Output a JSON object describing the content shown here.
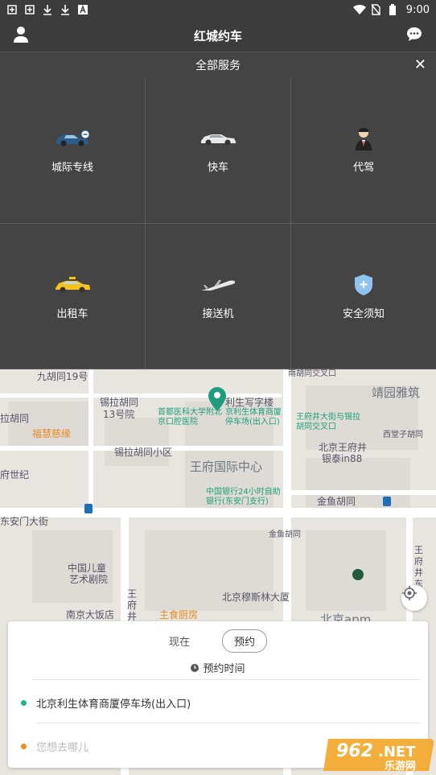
{
  "status_bar": {
    "time": "9:00"
  },
  "app_bar": {
    "title": "红城约车"
  },
  "services": {
    "header": "全部服务",
    "close_symbol": "✕",
    "items": [
      {
        "label": "城际专线",
        "icon": "intercity-car-icon"
      },
      {
        "label": "快车",
        "icon": "express-car-icon"
      },
      {
        "label": "代驾",
        "icon": "chauffeur-icon"
      },
      {
        "label": "出租车",
        "icon": "taxi-icon"
      },
      {
        "label": "接送机",
        "icon": "airplane-icon"
      },
      {
        "label": "安全须知",
        "icon": "shield-icon"
      }
    ]
  },
  "map": {
    "labels": [
      "九胡同19号",
      "锡拉胡同",
      "13号院",
      "拉胡同",
      "福慧慈缘",
      "锡拉胡同小区",
      "王府国际中心",
      "府世纪",
      "东安门大街",
      "中国儿童",
      "艺术剧院",
      "南京大饭店",
      "王府井",
      "主食厨房",
      "北京穆斯林大厦",
      "北京王府井",
      "银泰in88",
      "金鱼胡同",
      "金鱼胡同",
      "西堂子胡同",
      "王府井东街",
      "靖园雅筑",
      "利生写字楼",
      "首都医科大学附北京口腔医院",
      "京利生体育商厦停车场(出入口)",
      "王府井大街与锡拉胡同交叉口",
      "中国银行24小时自助银行(东安门支行)",
      "北京apm",
      "南胡同交叉口"
    ]
  },
  "booking": {
    "tab_now": "现在",
    "tab_book": "预约",
    "time_label": "预约时间",
    "origin": "北京利生体育商厦停车场(出入口)",
    "destination_placeholder": "您想去哪儿"
  },
  "watermark": {
    "text": "962.NET",
    "subtext": "乐游网"
  },
  "colors": {
    "origin_dot": "#21b38e",
    "dest_dot": "#f08d1f",
    "dark_bg": "#444444"
  }
}
